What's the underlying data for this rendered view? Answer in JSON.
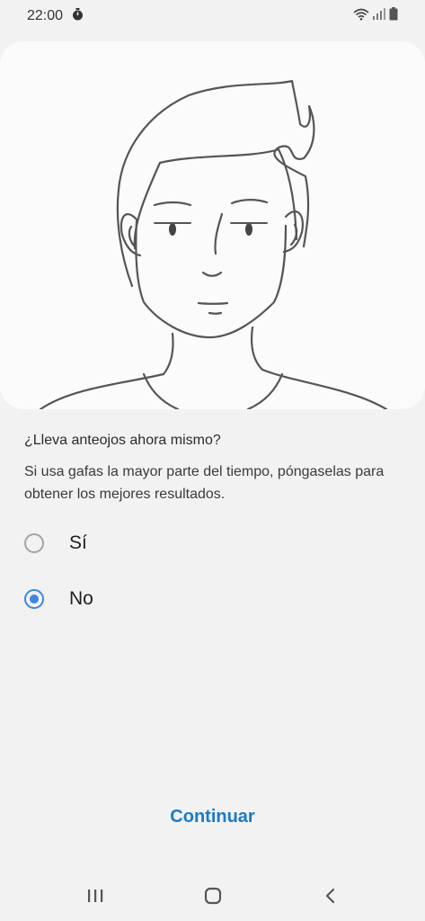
{
  "status_bar": {
    "time": "22:00",
    "timer_icon": "stopwatch-icon",
    "wifi_icon": "wifi-icon",
    "signal_icon": "cell-signal-icon",
    "battery_icon": "battery-icon"
  },
  "illustration": {
    "icon": "face-illustration"
  },
  "question": "¿Lleva anteojos ahora mismo?",
  "description": "Si usa gafas la mayor parte del tiempo, póngaselas para obtener los mejores resultados.",
  "options": [
    {
      "label": "Sí",
      "selected": false
    },
    {
      "label": "No",
      "selected": true
    }
  ],
  "continue_label": "Continuar",
  "colors": {
    "accent": "#3d86e4",
    "link": "#1a7ac9",
    "background": "#f2f2f2",
    "card": "#fbfbfb"
  },
  "nav_bar": {
    "recents_icon": "recent-apps-icon",
    "home_icon": "home-icon",
    "back_icon": "back-icon"
  }
}
